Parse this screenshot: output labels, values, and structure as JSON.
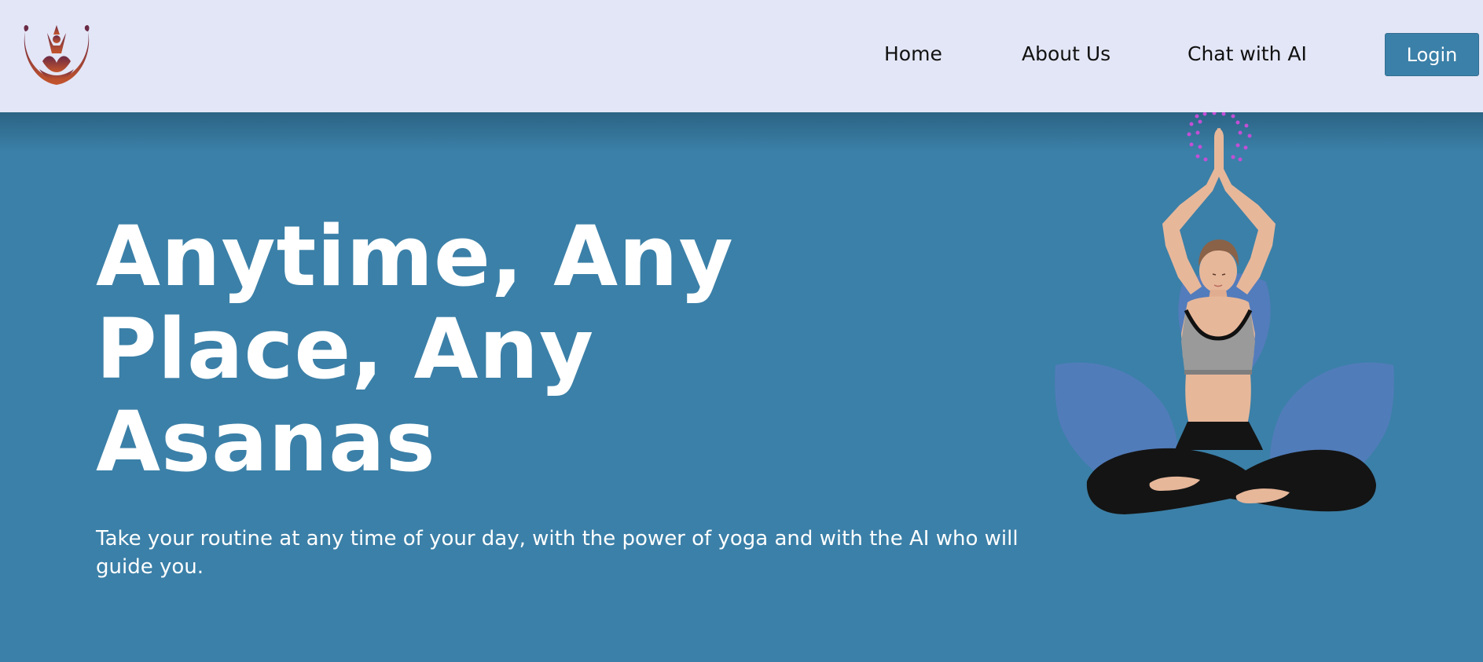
{
  "header": {
    "logo_alt": "meditating figure logo",
    "nav": {
      "home": "Home",
      "about": "About Us",
      "chat": "Chat with AI"
    },
    "login_label": "Login"
  },
  "hero": {
    "title": "Anytime, Any Place, Any Asanas",
    "subtitle": "Take your routine at any time of your day, with the power of yoga and with the AI who will guide you."
  },
  "colors": {
    "nav_background": "#e3e6f6",
    "hero_background": "#3b80a8",
    "button_background": "#3b80a8",
    "logo_gradient_top": "#6b2a45",
    "logo_gradient_bottom": "#c4552c"
  }
}
